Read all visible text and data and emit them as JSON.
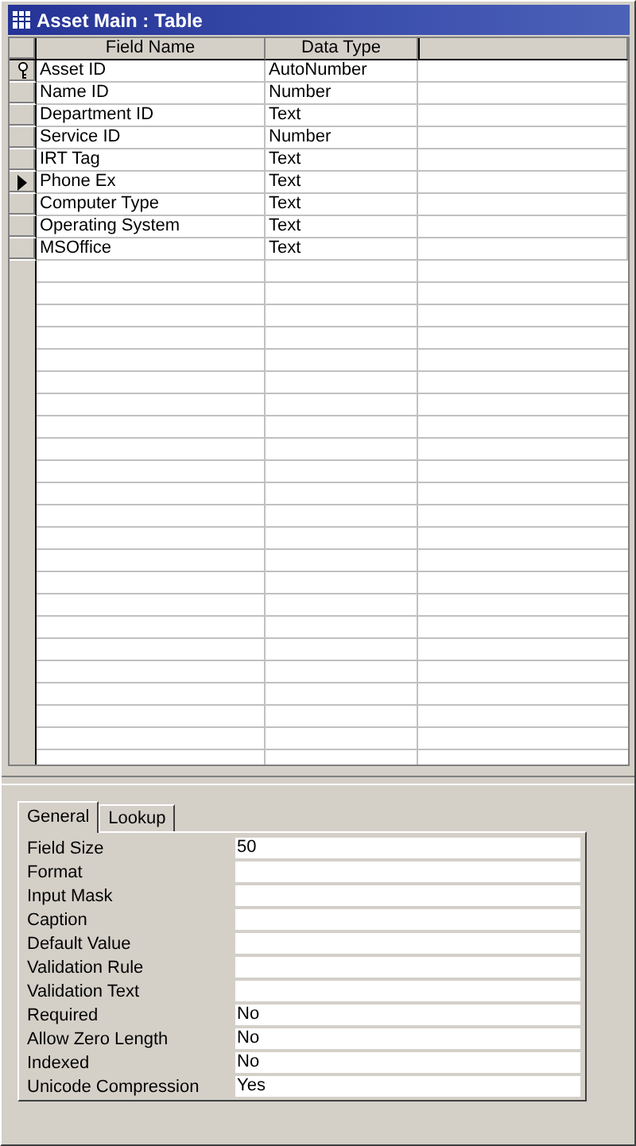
{
  "window": {
    "title": "Asset Main : Table"
  },
  "table": {
    "columns": [
      "Field Name",
      "Data Type"
    ],
    "rows": [
      {
        "field_name": "Asset ID",
        "data_type": "AutoNumber",
        "primary_key": true,
        "selected": false
      },
      {
        "field_name": "Name ID",
        "data_type": "Number",
        "primary_key": false,
        "selected": false
      },
      {
        "field_name": "Department ID",
        "data_type": "Text",
        "primary_key": false,
        "selected": false
      },
      {
        "field_name": "Service ID",
        "data_type": "Number",
        "primary_key": false,
        "selected": false
      },
      {
        "field_name": "IRT Tag",
        "data_type": "Text",
        "primary_key": false,
        "selected": false
      },
      {
        "field_name": "Phone Ex",
        "data_type": "Text",
        "primary_key": false,
        "selected": true
      },
      {
        "field_name": "Computer Type",
        "data_type": "Text",
        "primary_key": false,
        "selected": false
      },
      {
        "field_name": "Operating System",
        "data_type": "Text",
        "primary_key": false,
        "selected": false
      },
      {
        "field_name": "MSOffice",
        "data_type": "Text",
        "primary_key": false,
        "selected": false
      }
    ]
  },
  "field_properties": {
    "tabs": [
      {
        "label": "General",
        "selected": true
      },
      {
        "label": "Lookup",
        "selected": false
      }
    ],
    "properties": [
      {
        "label": "Field Size",
        "value": "50"
      },
      {
        "label": "Format"
      },
      {
        "label": "Input Mask"
      },
      {
        "label": "Caption"
      },
      {
        "label": "Default Value"
      },
      {
        "label": "Validation Rule"
      },
      {
        "label": "Validation Text"
      },
      {
        "label": "Required",
        "value": "No"
      },
      {
        "label": "Allow Zero Length",
        "value": "No"
      },
      {
        "label": "Indexed",
        "value": "No"
      },
      {
        "label": "Unicode Compression",
        "value": "Yes"
      }
    ]
  }
}
